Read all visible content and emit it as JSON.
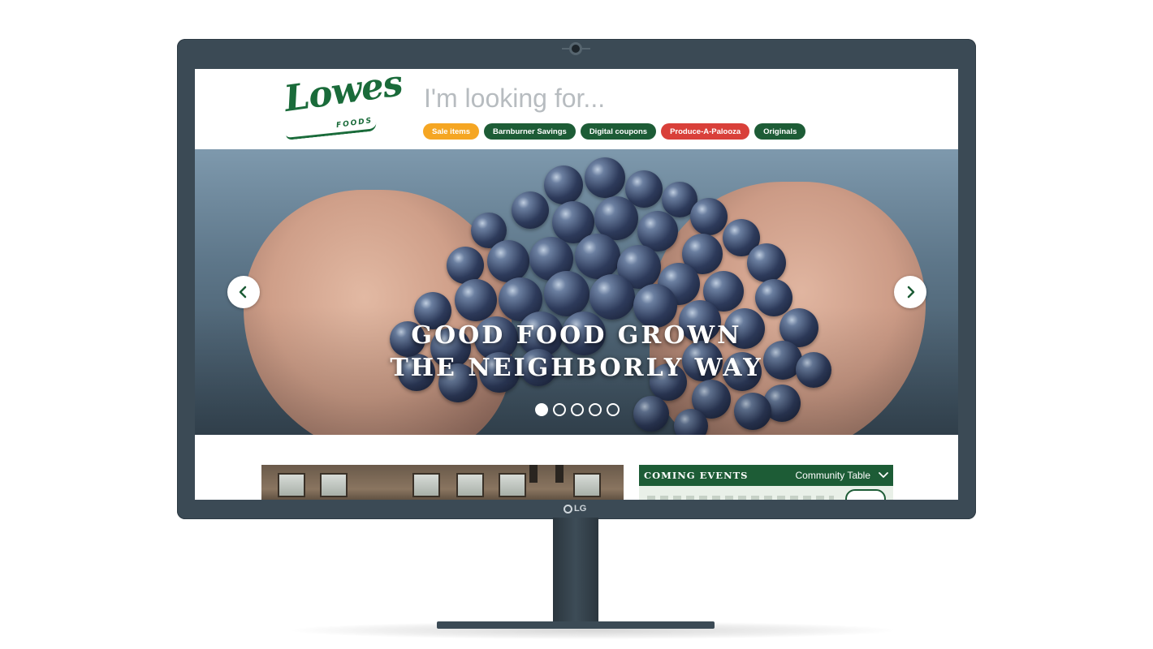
{
  "device": {
    "brand": "LG"
  },
  "site": {
    "logo": {
      "main": "Lowes",
      "sub": "FOODS"
    },
    "search": {
      "placeholder": "I'm looking for..."
    },
    "pills": [
      {
        "label": "Sale items",
        "color": "#f5a623"
      },
      {
        "label": "Barnburner Savings",
        "color": "#1d5c36"
      },
      {
        "label": "Digital coupons",
        "color": "#1d5c36"
      },
      {
        "label": "Produce-A-Palooza",
        "color": "#d9403a"
      },
      {
        "label": "Originals",
        "color": "#1d5c36"
      }
    ],
    "hero": {
      "line1": "GOOD FOOD GROWN",
      "line2": "THE NEIGHBORLY WAY",
      "slide_count": 5,
      "active_slide": 1
    },
    "events": {
      "title": "COMING EVENTS",
      "filter": "Community Table"
    }
  },
  "colors": {
    "brand_green": "#1d5c36",
    "logo_green": "#1a6b3a",
    "frame": "#3b4a55"
  }
}
